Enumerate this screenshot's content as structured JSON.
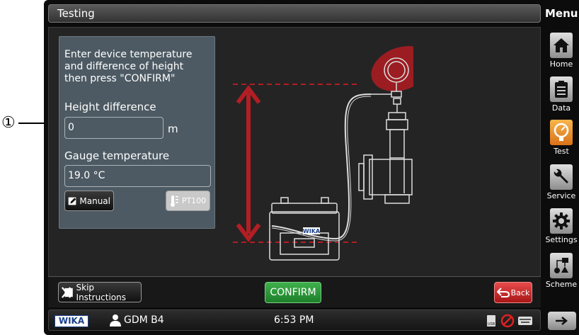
{
  "header": {
    "title": "Testing",
    "menu_label": "Menu"
  },
  "instructions": {
    "lines": [
      "Enter device temperature",
      "and difference of height",
      "then press \"CONFIRM\""
    ],
    "height_label": "Height difference",
    "height_value": "0",
    "height_unit": "m",
    "temp_label": "Gauge temperature",
    "temp_value": "19.0 °C",
    "manual_button": "Manual",
    "pt100_button": "PT100"
  },
  "diagram": {
    "case_badge": "WIKA"
  },
  "actions": {
    "skip_label": "Skip Instructions",
    "confirm_label": "CONFIRM",
    "back_label": "Back"
  },
  "status": {
    "logo": "WIKA",
    "user": "GDM B4",
    "time": "6:53 PM",
    "usb_label": "USB"
  },
  "menu": [
    {
      "label": "Home",
      "icon": "home-icon"
    },
    {
      "label": "Data",
      "icon": "clipboard-icon"
    },
    {
      "label": "Test",
      "icon": "gauge-icon",
      "active": true
    },
    {
      "label": "Service",
      "icon": "wrench-icon"
    },
    {
      "label": "Settings",
      "icon": "gear-icon"
    },
    {
      "label": "Scheme",
      "icon": "scheme-icon"
    }
  ],
  "callout": {
    "number": "①"
  },
  "colors": {
    "accent_red": "#b21e24",
    "confirm_green": "#2e9a3a",
    "active_orange": "#f0952e",
    "panel": "#4d5a63"
  }
}
